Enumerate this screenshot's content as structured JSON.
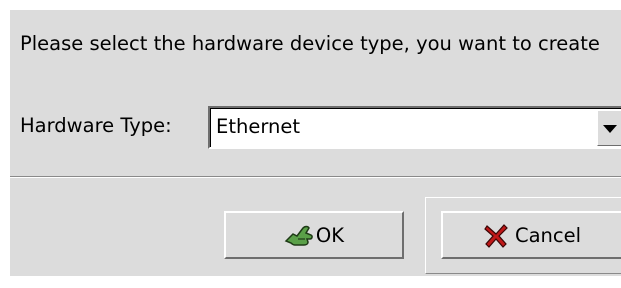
{
  "dialog": {
    "prompt": "Please select the hardware device type, you want to create",
    "hardware_type_label": "Hardware Type:",
    "hardware_type_value": "Ethernet"
  },
  "buttons": {
    "ok_label": "OK",
    "ok_icon": "ok-hand-icon",
    "cancel_label": "Cancel",
    "cancel_icon": "red-x-icon"
  },
  "colors": {
    "dialog_bg": "#dcdcdc",
    "field_bg": "#ffffff",
    "ok_icon_green": "#4a8c3a",
    "cancel_icon_red": "#c01818"
  }
}
